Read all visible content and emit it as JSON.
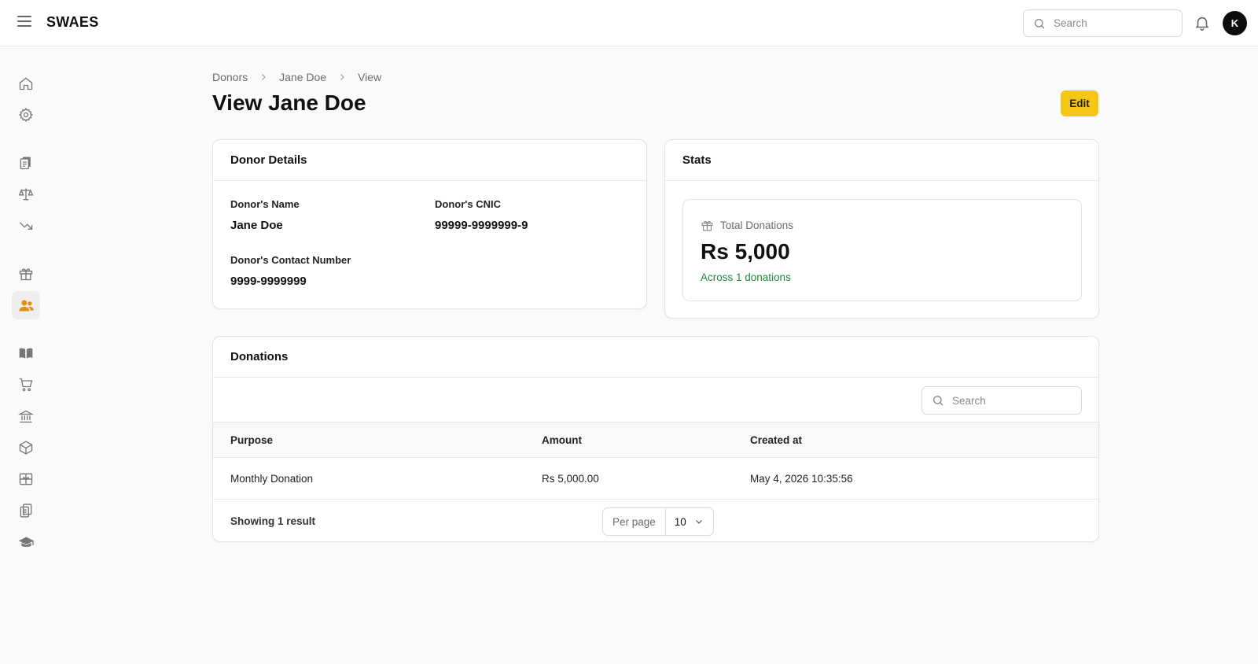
{
  "app": {
    "brand": "SWAES",
    "avatar_initial": "K",
    "accent_color": "#f5c518",
    "success_color": "#1e8a3a"
  },
  "header": {
    "search_placeholder": "Search"
  },
  "sidebar": {
    "items": [
      {
        "icon": "home-icon"
      },
      {
        "icon": "gear-icon"
      },
      {
        "icon": "documents-icon"
      },
      {
        "icon": "scale-icon"
      },
      {
        "icon": "trending-down-icon"
      },
      {
        "icon": "gift-icon"
      },
      {
        "icon": "users-icon",
        "active": true
      },
      {
        "icon": "book-icon"
      },
      {
        "icon": "cart-icon"
      },
      {
        "icon": "bank-icon"
      },
      {
        "icon": "box-icon"
      },
      {
        "icon": "gift-card-icon"
      },
      {
        "icon": "clipboard-icon"
      },
      {
        "icon": "graduation-cap-icon"
      }
    ]
  },
  "breadcrumb": {
    "items": [
      "Donors",
      "Jane Doe",
      "View"
    ]
  },
  "page": {
    "title": "View Jane Doe",
    "edit_label": "Edit"
  },
  "donor_details": {
    "title": "Donor Details",
    "name_label": "Donor's Name",
    "name_value": "Jane Doe",
    "cnic_label": "Donor's CNIC",
    "cnic_value": "99999-9999999-9",
    "contact_label": "Donor's Contact Number",
    "contact_value": "9999-9999999"
  },
  "stats": {
    "title": "Stats",
    "total_label": "Total Donations",
    "total_value": "Rs 5,000",
    "total_sub": "Across 1 donations"
  },
  "donations": {
    "title": "Donations",
    "search_placeholder": "Search",
    "columns": [
      "Purpose",
      "Amount",
      "Created at"
    ],
    "rows": [
      {
        "purpose": "Monthly Donation",
        "amount": "Rs 5,000.00",
        "created_at": "May 4, 2026 10:35:56"
      }
    ],
    "showing": "Showing 1 result",
    "per_page_label": "Per page",
    "per_page_value": "10"
  }
}
